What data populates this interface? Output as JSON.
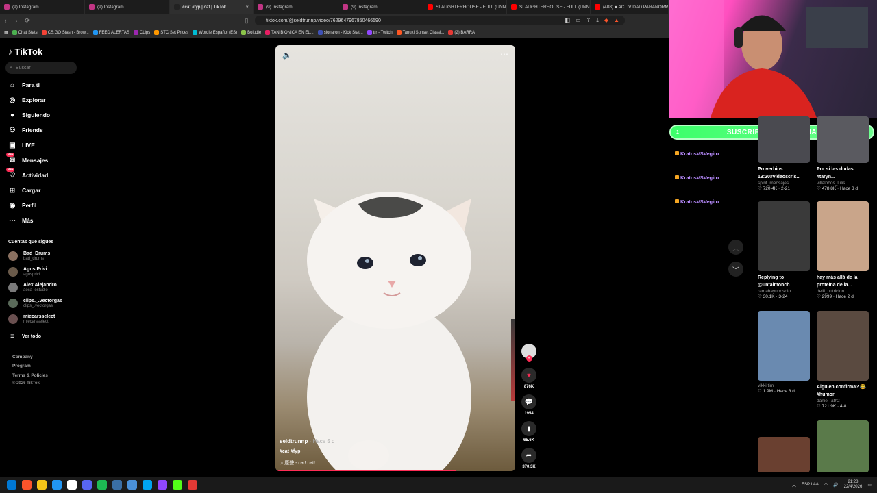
{
  "browser": {
    "tabs": [
      {
        "label": "(9) Instagram",
        "color": "#c13584"
      },
      {
        "label": "(9) Instagram",
        "color": "#c13584"
      },
      {
        "label": "#cat #fyp | cat | TikTok",
        "color": "#222222",
        "active": true
      },
      {
        "label": "(9) Instagram",
        "color": "#c13584"
      },
      {
        "label": "(9) Instagram",
        "color": "#c13584"
      },
      {
        "label": "SLAUGHTERHOUSE - FULL (UNNERF",
        "color": "#ff0000"
      },
      {
        "label": "SLAUGHTERHOUSE - FULL (UNNERF",
        "color": "#ff0000"
      },
      {
        "label": "(408) ● ACTIVIDAD PARANORMAL",
        "color": "#ff0000"
      }
    ],
    "tab_close": "×",
    "url": "tiktok.com/@seldtrunnp/video/762964796785046659​0",
    "bookmarks": [
      "Chat Stats",
      "CS:GO Stash - Brow...",
      "FEED ALERTAS",
      "CLips",
      "STC Set Prices",
      "Wordle Español (ES)",
      "Boludle",
      "TAN BIONICA EN EL...",
      "sionaron - Kick Stat...",
      "trr - Twitch",
      "Tanuki Sunset Classi...",
      "(2) BARRA"
    ]
  },
  "tiktok": {
    "logo": "TikTok",
    "search_placeholder": "Buscar",
    "nav": [
      {
        "label": "Para ti",
        "icon": "home-icon"
      },
      {
        "label": "Explorar",
        "icon": "compass-icon"
      },
      {
        "label": "Siguiendo",
        "icon": "following-icon"
      },
      {
        "label": "Friends",
        "icon": "friends-icon"
      },
      {
        "label": "LIVE",
        "icon": "live-icon"
      },
      {
        "label": "Mensajes",
        "icon": "messages-icon",
        "badge": "99+"
      },
      {
        "label": "Actividad",
        "icon": "activity-icon",
        "badge": "99+"
      },
      {
        "label": "Cargar",
        "icon": "upload-icon"
      },
      {
        "label": "Perfil",
        "icon": "profile-icon"
      },
      {
        "label": "Más",
        "icon": "more-icon"
      }
    ],
    "following_title": "Cuentas que sigues",
    "following": [
      {
        "name": "Bad_Drums",
        "handle": "bad_drums"
      },
      {
        "name": "Agus Privi",
        "handle": "agusprivi"
      },
      {
        "name": "Alex Alejandro",
        "handle": "aoca_estudio"
      },
      {
        "name": "clips._.vectorgas",
        "handle": "clips_.vectorgas"
      },
      {
        "name": "miecarsselect",
        "handle": "miecarsselect"
      }
    ],
    "see_all": "Ver todo",
    "footer": [
      "Company",
      "Program",
      "Terms & Policies",
      "© 2026 TikTok"
    ]
  },
  "video": {
    "author": "seldtrunnp",
    "when": "· Hace 5 d",
    "tags": "#cat #fyp",
    "sound": "♫  原聲 - cat! cat!",
    "progress": 0.75,
    "likes": "876K",
    "comments": "1954",
    "saves": "65.6K",
    "shares": "370.3K"
  },
  "stream": {
    "sub_banner": "SUSCRIPTORES DEL DIA",
    "sub_left": "1",
    "sub_right": "1",
    "chat": [
      "KratosVSVegito",
      "KratosVSVegito",
      "KratosVSVegito"
    ]
  },
  "recommend": [
    {
      "title": "Proverbios 13:20#videoscris...",
      "user": "spirit_mensajes",
      "meta": "♡ 720.4K · 2-21"
    },
    {
      "title": "Por si las dudas #taryn...",
      "user": "villalobos_lulis",
      "meta": "♡ 478.8K · Hace 3 d"
    },
    {
      "title": "Replying to @untalmonch",
      "user": "ramahayunosolo",
      "meta": "♡ 30.1K · 3-24"
    },
    {
      "title": "hay más allá de la proteína de la...",
      "user": "delfi_nutricion",
      "meta": "♡ 2999 · Hace 2 d"
    },
    {
      "title": "",
      "user": "vikki.tim",
      "meta": "♡ 1.9M · Hace 3 d"
    },
    {
      "title": "Alguien confirma? 😂#humor",
      "user": "daniel_ath2",
      "meta": "♡ 721.9K · 4-8"
    }
  ],
  "taskbar": {
    "lang": "ESP LAA",
    "time": "21:28",
    "date": "22/4/2026"
  }
}
